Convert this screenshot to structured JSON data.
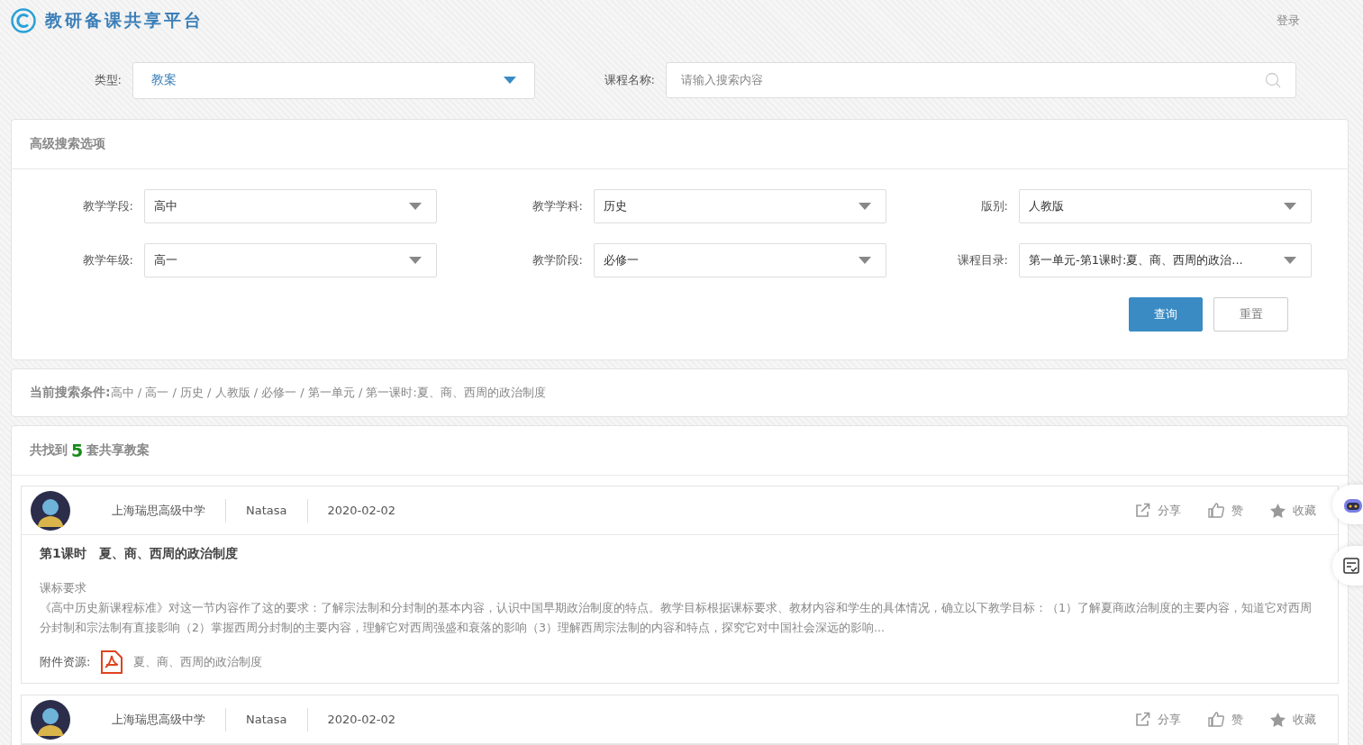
{
  "header": {
    "title": "教研备课共享平台",
    "login": "登录"
  },
  "search": {
    "type_label": "类型:",
    "type_value": "教案",
    "name_label": "课程名称:",
    "name_placeholder": "请输入搜索内容"
  },
  "advanced": {
    "title": "高级搜索选项",
    "fields": [
      {
        "label": "教学学段:",
        "value": "高中"
      },
      {
        "label": "教学学科:",
        "value": "历史"
      },
      {
        "label": "版别:",
        "value": "人教版"
      },
      {
        "label": "教学年级:",
        "value": "高一"
      },
      {
        "label": "教学阶段:",
        "value": "必修一"
      },
      {
        "label": "课程目录:",
        "value": "第一单元-第1课时:夏、商、西周的政治..."
      }
    ],
    "buttons": [
      {
        "label": "查询",
        "kind": "primary"
      },
      {
        "label": "重置",
        "kind": "secondary"
      }
    ]
  },
  "conditions": {
    "label": "当前搜索条件:",
    "value": "高中 / 高一 / 历史 / 人教版 / 必修一 / 第一单元 / 第一课时:夏、商、西周的政治制度"
  },
  "results": {
    "prefix": "共找到",
    "count": "5",
    "suffix": "套共享教案",
    "items": [
      {
        "school": "上海瑞思高级中学",
        "author": "Natasa",
        "date": "2020-02-02",
        "actions": [
          "分享",
          "赞",
          "收藏"
        ],
        "title": "第1课时　夏、商、西周的政治制度",
        "section": "课标要求",
        "description": "《高中历史新课程标准》对这一节内容作了这的要求：了解宗法制和分封制的基本内容，认识中国早期政治制度的特点。教学目标根据课标要求、教材内容和学生的具体情况，确立以下教学目标：（1）了解夏商政治制度的主要内容，知道它对西周分封制和宗法制有直接影响（2）掌握西周分封制的主要内容，理解它对西周强盛和衰落的影响（3）理解西周宗法制的内容和特点，探究它对中国社会深远的影响...",
        "attachment_label": "附件资源:",
        "attachment": "夏、商、西周的政治制度"
      },
      {
        "school": "上海瑞思高级中学",
        "author": "Natasa",
        "date": "2020-02-02",
        "actions": [
          "分享",
          "赞",
          "收藏"
        ]
      }
    ]
  }
}
